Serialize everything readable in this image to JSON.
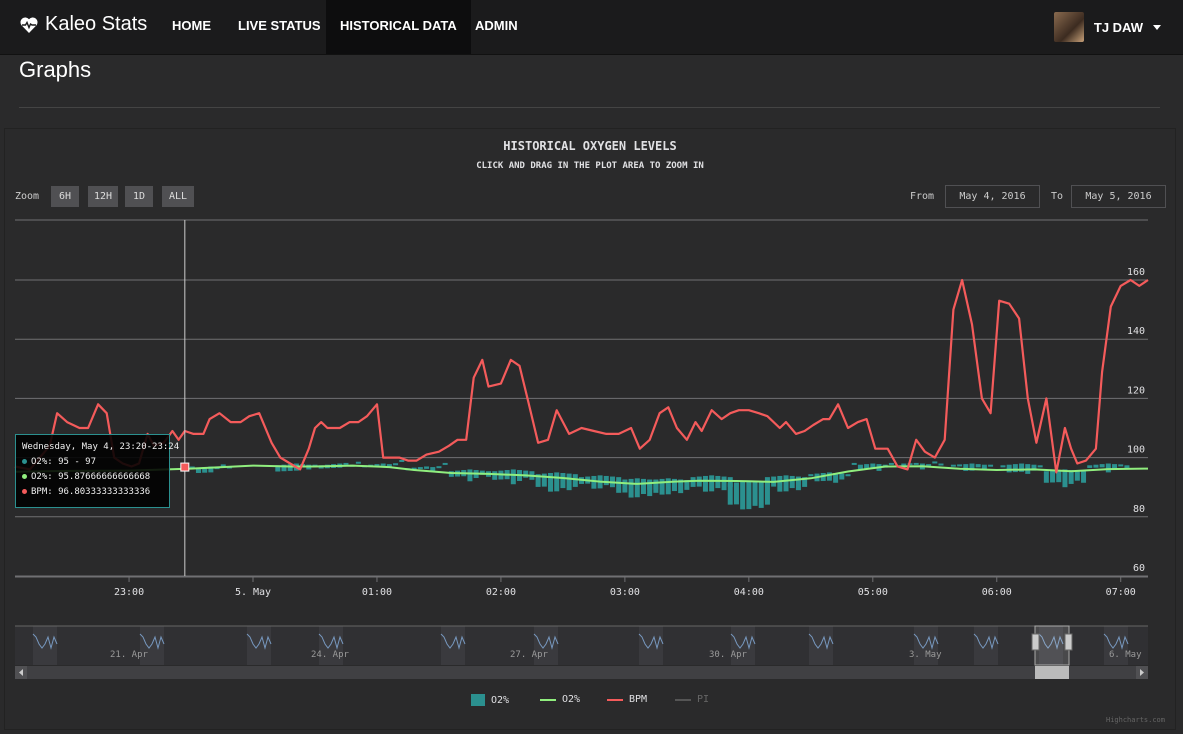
{
  "navbar": {
    "brand": "Kaleo Stats",
    "items": [
      "HOME",
      "LIVE STATUS",
      "HISTORICAL DATA",
      "ADMIN"
    ],
    "active": "HISTORICAL DATA",
    "user": "TJ DAW"
  },
  "page": {
    "title": "Graphs"
  },
  "controls": {
    "zoom_label": "Zoom",
    "zoom_buttons": [
      "6H",
      "12H",
      "1D",
      "ALL"
    ],
    "from_label": "From",
    "from_value": "May 4, 2016",
    "to_label": "To",
    "to_value": "May 5, 2016"
  },
  "tooltip": {
    "header": "Wednesday, May 4, 23:20-23:24",
    "o2_range": "O2%: 95 - 97",
    "o2_avg": "O2%: 95.87666666666668",
    "bpm": "BPM: 96.80333333333336"
  },
  "colors": {
    "o2_bar": "#2b908f",
    "o2_line": "#90ee7e",
    "bpm": "#f45b5b",
    "pi": "#7798bf"
  },
  "chart_data": {
    "type": "line",
    "title": "HISTORICAL OXYGEN LEVELS",
    "subtitle": "CLICK AND DRAG IN THE PLOT AREA TO ZOOM IN",
    "x_tick_labels": [
      "23:00",
      "5. May",
      "01:00",
      "02:00",
      "03:00",
      "04:00",
      "05:00",
      "06:00",
      "07:00"
    ],
    "x_ticks_hours": [
      -1,
      0,
      1,
      2,
      3,
      4,
      5,
      6,
      7
    ],
    "x_range_hours": [
      -1.92,
      7.22
    ],
    "y_ticks": [
      60,
      80,
      100,
      120,
      140,
      160
    ],
    "ylim": [
      60,
      160
    ],
    "navigator_labels": [
      "21. Apr",
      "24. Apr",
      "27. Apr",
      "30. Apr",
      "3. May",
      "6. May"
    ],
    "legend": [
      "O2%",
      "O2%",
      "BPM",
      "PI"
    ],
    "series": [
      {
        "name": "BPM",
        "x": [
          -1.92,
          -1.8,
          -1.64,
          -1.58,
          -1.5,
          -1.4,
          -1.33,
          -1.25,
          -1.18,
          -1.12,
          -1.05,
          -0.98,
          -0.92,
          -0.85,
          -0.8,
          -0.72,
          -0.65,
          -0.6,
          -0.55,
          -0.48,
          -0.4,
          -0.35,
          -0.27,
          -0.18,
          -0.1,
          -0.03,
          0.05,
          0.15,
          0.22,
          0.3,
          0.38,
          0.45,
          0.5,
          0.55,
          0.6,
          0.7,
          0.78,
          0.85,
          0.92,
          1.0,
          1.05,
          1.1,
          1.18,
          1.25,
          1.32,
          1.4,
          1.5,
          1.58,
          1.65,
          1.72,
          1.78,
          1.85,
          1.9,
          2.0,
          2.08,
          2.15,
          2.22,
          2.3,
          2.38,
          2.45,
          2.55,
          2.65,
          2.75,
          2.85,
          2.95,
          3.05,
          3.12,
          3.2,
          3.28,
          3.35,
          3.42,
          3.5,
          3.57,
          3.62,
          3.7,
          3.78,
          3.85,
          3.92,
          4.0,
          4.08,
          4.15,
          4.25,
          4.3,
          4.38,
          4.45,
          4.52,
          4.6,
          4.65,
          4.72,
          4.8,
          4.88,
          4.95,
          5.02,
          5.12,
          5.2,
          5.28,
          5.35,
          5.42,
          5.5,
          5.58,
          5.65,
          5.72,
          5.8,
          5.88,
          5.95,
          6.02,
          6.1,
          6.18,
          6.25,
          6.32,
          6.4,
          6.48,
          6.55,
          6.6,
          6.65,
          6.72,
          6.8,
          6.85,
          6.92,
          7.0,
          7.08,
          7.15,
          7.22
        ],
        "values": [
          97,
          96,
          104,
          115,
          112,
          110,
          110,
          118,
          115,
          100,
          98,
          97,
          98,
          108,
          104,
          105,
          109,
          106,
          109,
          108,
          108,
          113,
          115,
          112,
          112,
          114,
          115,
          105,
          100,
          98,
          96,
          103,
          110,
          112,
          110,
          110,
          112,
          112,
          114,
          118,
          100,
          100,
          100,
          99,
          99,
          101,
          102,
          104,
          106,
          106,
          127,
          133,
          124,
          125,
          133,
          131,
          119,
          105,
          106,
          116,
          108,
          110,
          109,
          108,
          108,
          110,
          103,
          106,
          115,
          117,
          110,
          106,
          112,
          109,
          116,
          113,
          115,
          116,
          116,
          115,
          114,
          110,
          112,
          108,
          109,
          111,
          113,
          113,
          118,
          110,
          112,
          113,
          103,
          103,
          97,
          96,
          106,
          102,
          100,
          106,
          150,
          160,
          145,
          120,
          115,
          153,
          152,
          147,
          120,
          105,
          120,
          95,
          110,
          103,
          98,
          99,
          103,
          129,
          151,
          158,
          160,
          158,
          160
        ]
      },
      {
        "name": "O2%",
        "x": [
          -1.92,
          -1.5,
          -1.0,
          -0.5,
          0.0,
          0.3,
          0.5,
          0.8,
          1.1,
          1.3,
          1.6,
          1.9,
          2.2,
          2.5,
          2.8,
          3.1,
          3.4,
          3.6,
          3.9,
          4.0,
          4.2,
          4.5,
          4.8,
          5.1,
          5.4,
          5.7,
          6.0,
          6.3,
          6.6,
          6.9,
          7.22
        ],
        "values": [
          95.2,
          95.5,
          95.6,
          96.3,
          97.3,
          97.0,
          97.0,
          97.3,
          96.8,
          95.8,
          94.8,
          94.5,
          94.0,
          93.1,
          91.9,
          91.1,
          91.9,
          92.2,
          92.1,
          92.0,
          91.8,
          93.0,
          95.3,
          97.0,
          97.1,
          96.2,
          95.8,
          96.0,
          95.4,
          96.1,
          96.3
        ]
      }
    ],
    "bars_note": "O2% range columns per interval",
    "bars": [
      {
        "x": -0.34,
        "low": 95,
        "high": 97
      },
      {
        "x": 0.35,
        "low": 95,
        "high": 98
      },
      {
        "x": 0.7,
        "low": 96,
        "high": 98
      },
      {
        "x": 1.05,
        "low": 96,
        "high": 98
      },
      {
        "x": 1.4,
        "low": 95,
        "high": 97
      },
      {
        "x": 1.75,
        "low": 92,
        "high": 96
      },
      {
        "x": 2.1,
        "low": 91,
        "high": 96
      },
      {
        "x": 2.45,
        "low": 88,
        "high": 95
      },
      {
        "x": 2.8,
        "low": 89,
        "high": 94
      },
      {
        "x": 3.1,
        "low": 86,
        "high": 93
      },
      {
        "x": 3.35,
        "low": 87,
        "high": 93
      },
      {
        "x": 3.7,
        "low": 88,
        "high": 94
      },
      {
        "x": 4.0,
        "low": 82,
        "high": 92
      },
      {
        "x": 4.3,
        "low": 88,
        "high": 94
      },
      {
        "x": 4.65,
        "low": 91,
        "high": 95
      },
      {
        "x": 5.0,
        "low": 95,
        "high": 98
      },
      {
        "x": 5.4,
        "low": 96,
        "high": 98
      },
      {
        "x": 5.8,
        "low": 95,
        "high": 98
      },
      {
        "x": 6.2,
        "low": 94,
        "high": 98
      },
      {
        "x": 6.55,
        "low": 90,
        "high": 96
      },
      {
        "x": 6.9,
        "low": 95,
        "high": 98
      }
    ]
  }
}
